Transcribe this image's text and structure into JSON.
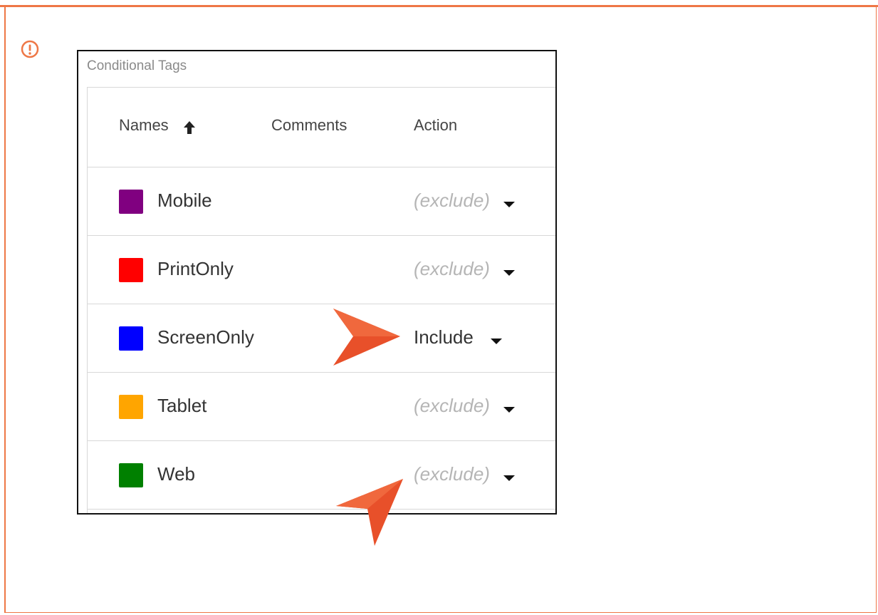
{
  "colors": {
    "frame_border": "#ee7746",
    "pointer": "#e8502a"
  },
  "icons": {
    "callout": "exclamation-circle-icon",
    "sort": "arrow-up-icon",
    "dropdown": "caret-down-icon",
    "pointer": "arrow-pointer-icon"
  },
  "panel": {
    "title": "Conditional Tags"
  },
  "table": {
    "columns": [
      "Names",
      "Comments",
      "Action"
    ],
    "rows": [
      {
        "name": "Mobile",
        "color": "#800080",
        "comment": "",
        "action": "(exclude)"
      },
      {
        "name": "PrintOnly",
        "color": "#ff0000",
        "comment": "",
        "action": "(exclude)"
      },
      {
        "name": "ScreenOnly",
        "color": "#0000ff",
        "comment": "",
        "action": "Include"
      },
      {
        "name": "Tablet",
        "color": "#ffa500",
        "comment": "",
        "action": "(exclude)"
      },
      {
        "name": "Web",
        "color": "#008000",
        "comment": "",
        "action": "(exclude)"
      }
    ]
  }
}
